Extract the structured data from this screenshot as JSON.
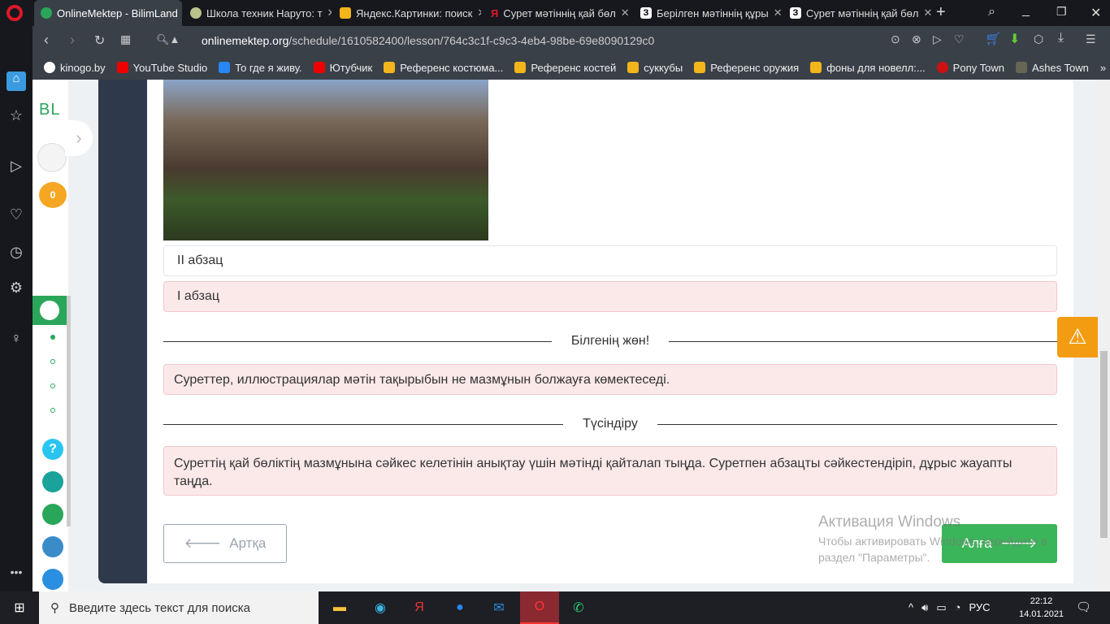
{
  "browser": {
    "tabs": [
      {
        "label": "OnlineMektep - BilimLand",
        "active": true
      },
      {
        "label": "Школа техник Наруто: т"
      },
      {
        "label": "Яндекс.Картинки: поиск"
      },
      {
        "label": "Сурет мәтіннің қай бөл"
      },
      {
        "label": "Берілген мәтіннің құры"
      },
      {
        "label": "Сурет мәтіннің қай бөл"
      }
    ],
    "url_host": "onlinemektep.org",
    "url_path": "/schedule/1610582400/lesson/764c3c1f-c9c3-4eb4-98be-69e8090129c0",
    "bookmarks": [
      "kinogo.by",
      "YouTube Studio",
      "То где я живу.",
      "Ютубчик",
      "Референс костюма...",
      "Референс костей",
      "суккубы",
      "Референс оружия",
      "фоны для новелл:...",
      "Pony Town",
      "Ashes Town"
    ]
  },
  "app": {
    "logo": "BL",
    "coins": "0",
    "help": "?"
  },
  "lesson": {
    "options": [
      "II абзац",
      "I абзац"
    ],
    "know_title": "Білгенің жөн!",
    "know_text": "Суреттер, иллюстрациялар мәтін тақырыбын не мазмұнын болжауға көмектеседі.",
    "explain_title": "Түсіндіру",
    "explain_text": "Суреттің қай бөліктің мазмұнына сәйкес келетінін анықтау үшін мәтінді қайталап тыңда. Суретпен абзацты сәйкестендіріп, дұрыс жауапты таңда.",
    "back_label": "Артқа",
    "next_label": "Алға"
  },
  "watermark": {
    "title": "Активация Windows",
    "text": "Чтобы активировать Windows, перейдите в раздел \"Параметры\"."
  },
  "taskbar": {
    "search_placeholder": "Введите здесь текст для поиска",
    "lang": "РУС",
    "time": "22:12",
    "date": "14.01.2021"
  }
}
